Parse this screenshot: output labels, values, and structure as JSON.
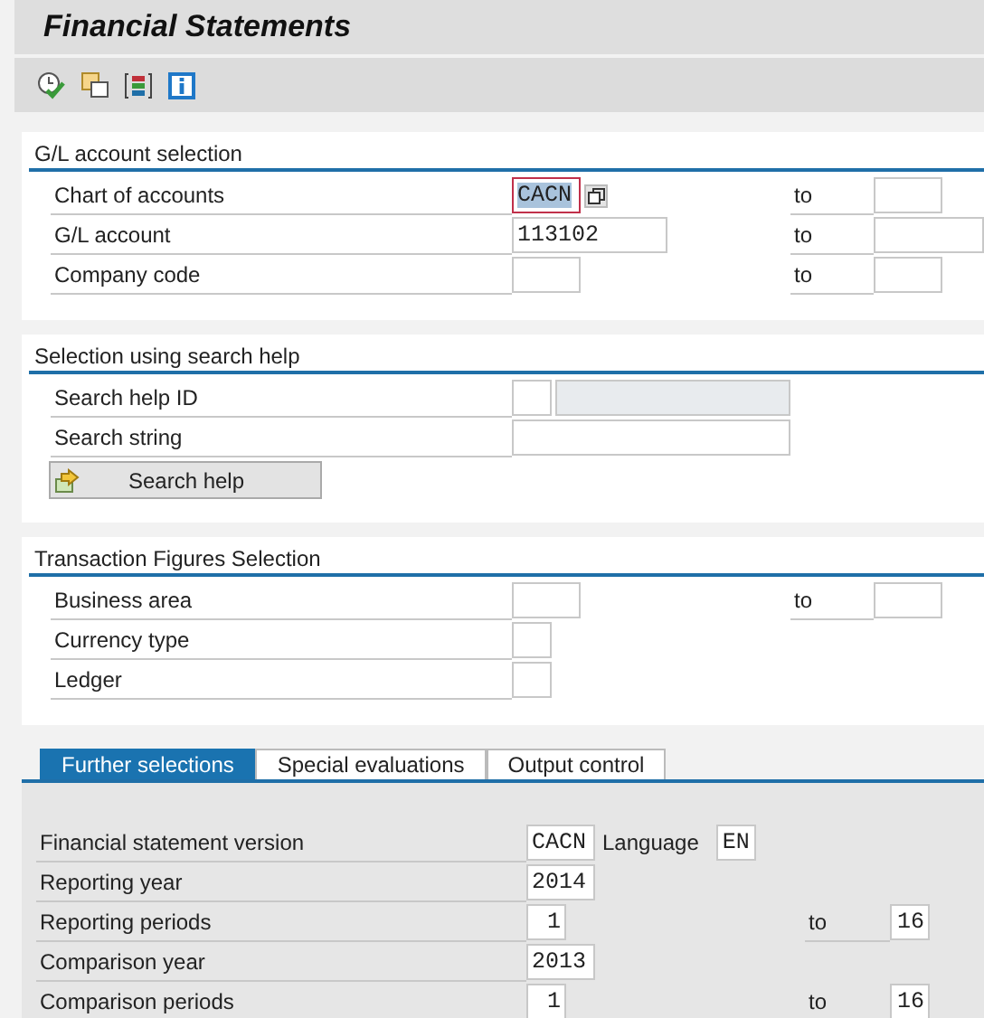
{
  "title": "Financial Statements",
  "toolbar": [
    {
      "kind": "execute"
    },
    {
      "kind": "variants"
    },
    {
      "kind": "layout"
    },
    {
      "kind": "info"
    }
  ],
  "sections": [
    {
      "title": "G/L account selection",
      "rows": [
        {
          "label": "Chart of accounts",
          "fields": [
            {
              "kind": "short",
              "value": "CACN",
              "focused": true,
              "disabled": false
            }
          ],
          "to": {
            "label": "to",
            "field": {
              "kind": "short",
              "focused": false,
              "disabled": false
            }
          }
        },
        {
          "label": "G/L account",
          "fields": [
            {
              "kind": "long",
              "value": "113102",
              "focused": false,
              "disabled": false
            }
          ],
          "to": {
            "label": "to",
            "field": {
              "kind": "wide",
              "focused": false,
              "disabled": false
            }
          }
        },
        {
          "label": "Company code",
          "fields": [
            {
              "kind": "short",
              "focused": false,
              "disabled": false
            }
          ],
          "to": {
            "label": "to",
            "field": {
              "kind": "short",
              "focused": false,
              "disabled": false
            }
          }
        }
      ]
    },
    {
      "title": "Selection using search help",
      "rows": [
        {
          "label": "Search help ID",
          "fields": [
            {
              "kind": "flag",
              "focused": false,
              "disabled": false
            },
            {
              "kind": "wide",
              "focused": false,
              "disabled": true
            }
          ]
        },
        {
          "label": "Search string",
          "fields": [
            {
              "kind": "wide",
              "focused": false,
              "disabled": false
            }
          ]
        }
      ],
      "button": "Search help"
    },
    {
      "title": "Transaction Figures Selection",
      "rows": [
        {
          "label": "Business area",
          "fields": [
            {
              "kind": "short",
              "focused": false,
              "disabled": false
            }
          ],
          "to": {
            "label": "to",
            "field": {
              "kind": "short",
              "focused": false,
              "disabled": false
            }
          }
        },
        {
          "label": "Currency type",
          "fields": [
            {
              "kind": "flag",
              "focused": false,
              "disabled": false
            }
          ]
        },
        {
          "label": "Ledger",
          "fields": [
            {
              "kind": "flag",
              "focused": false,
              "disabled": false
            }
          ]
        }
      ]
    }
  ],
  "tabs": [
    {
      "label": "Further selections",
      "selected": true
    },
    {
      "label": "Special evaluations",
      "selected": false
    },
    {
      "label": "Output control",
      "selected": false
    }
  ],
  "tab_rows": [
    {
      "label": "Financial statement version",
      "fields": [
        {
          "kind": "short",
          "value": "CACN",
          "focused": false,
          "disabled": false
        },
        {
          "kind": "text",
          "value": "Language"
        },
        {
          "kind": "flag",
          "value": "EN",
          "focused": false,
          "disabled": false
        }
      ]
    },
    {
      "label": "Reporting year",
      "fields": [
        {
          "kind": "short",
          "value": "2014",
          "focused": false,
          "disabled": false
        }
      ]
    },
    {
      "label": "Reporting periods",
      "fields": [
        {
          "kind": "flag",
          "value": "1",
          "focused": false,
          "disabled": false
        }
      ],
      "to": {
        "label": "to",
        "field": {
          "kind": "flag",
          "value": "16",
          "focused": false,
          "disabled": false
        }
      }
    },
    {
      "label": "Comparison year",
      "fields": [
        {
          "kind": "short",
          "value": "2013",
          "focused": false,
          "disabled": false
        }
      ]
    },
    {
      "label": "Comparison periods",
      "fields": [
        {
          "kind": "flag",
          "value": "1",
          "focused": false,
          "disabled": false
        }
      ],
      "to": {
        "label": "to",
        "field": {
          "kind": "flag",
          "value": "16",
          "focused": false,
          "disabled": false
        }
      }
    }
  ]
}
